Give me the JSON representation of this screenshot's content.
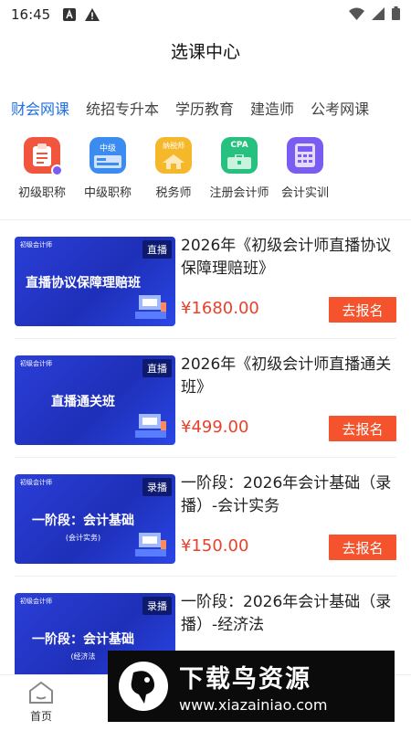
{
  "status_bar": {
    "time": "16:45",
    "icons": [
      "text-a-icon",
      "warning-icon",
      "wifi-icon",
      "signal-icon",
      "battery-icon"
    ]
  },
  "header": {
    "title": "选课中心"
  },
  "tabs": [
    {
      "label": "财会网课",
      "active": true
    },
    {
      "label": "统招专升本",
      "active": false
    },
    {
      "label": "学历教育",
      "active": false
    },
    {
      "label": "建造师",
      "active": false
    },
    {
      "label": "公考网课",
      "active": false
    }
  ],
  "categories": [
    {
      "label": "初级职称",
      "icon": "clipboard-icon",
      "color": "#f2553d"
    },
    {
      "label": "中级职称",
      "icon": "calculator-screen-icon",
      "color": "#3b8cf0",
      "icon_text": "中级"
    },
    {
      "label": "税务师",
      "icon": "tax-house-icon",
      "color": "#f6b82b",
      "icon_text": "纳税师"
    },
    {
      "label": "注册会计师",
      "icon": "briefcase-icon",
      "color": "#26c07f",
      "icon_text": "CPA"
    },
    {
      "label": "会计实训",
      "icon": "calculator-icon",
      "color": "#7a5cf0"
    }
  ],
  "courses": [
    {
      "name": "2026年《初级会计师直播协议保障理赔班》",
      "price": "¥1680.00",
      "button": "去报名",
      "thumb": {
        "org": "初级会计师",
        "badge": "直播",
        "title": "直播协议保障理赔班",
        "sub": ""
      }
    },
    {
      "name": "2026年《初级会计师直播通关班》",
      "price": "¥499.00",
      "button": "去报名",
      "thumb": {
        "org": "初级会计师",
        "badge": "直播",
        "title": "直播通关班",
        "sub": ""
      }
    },
    {
      "name": "一阶段：2026年会计基础（录播）-会计实务",
      "price": "¥150.00",
      "button": "去报名",
      "thumb": {
        "org": "初级会计师",
        "badge": "录播",
        "title": "一阶段：会计基础",
        "sub": "(会计实务)"
      }
    },
    {
      "name": "一阶段：2026年会计基础（录播）-经济法",
      "price": "",
      "button": "",
      "thumb": {
        "org": "初级会计师",
        "badge": "录播",
        "title": "一阶段：会计基础",
        "sub": "(经济法"
      }
    }
  ],
  "bottom_nav": {
    "home_label": "首页"
  },
  "watermark": {
    "text": "下载鸟资源",
    "url": "www.xiazainiao.com"
  }
}
